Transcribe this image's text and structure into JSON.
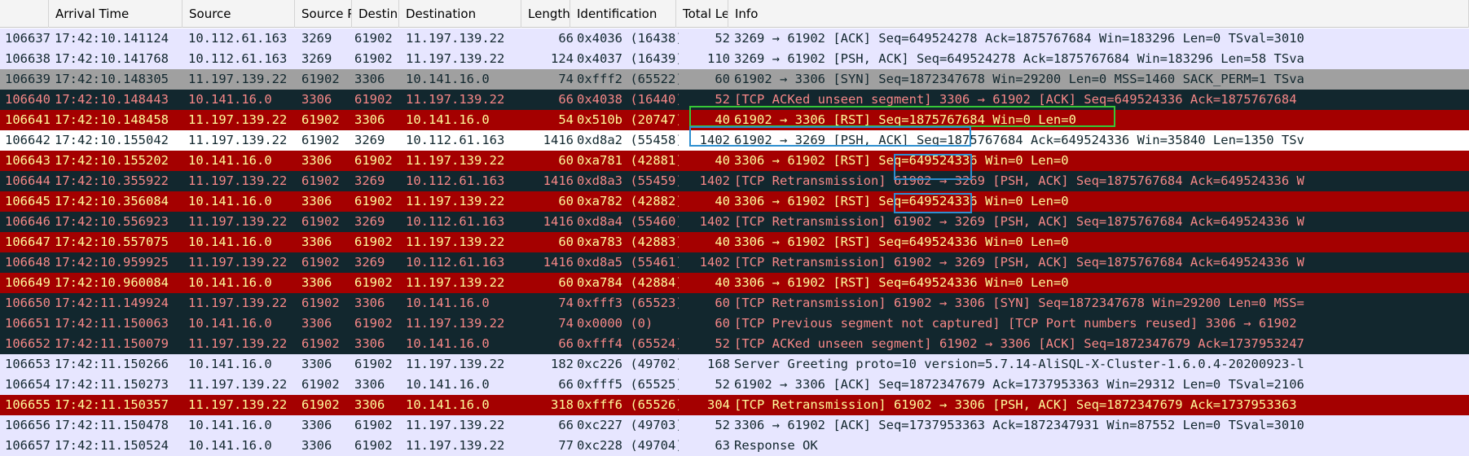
{
  "columns": [
    "",
    "Arrival Time",
    "Source",
    "Source P",
    "Destina",
    "Destination",
    "Length",
    "Identification",
    "Total Le",
    "Info"
  ],
  "styles": {
    "normal": {
      "bg": "#e7e6ff",
      "fg": "#12272e"
    },
    "white": {
      "bg": "#ffffff",
      "fg": "#12272e"
    },
    "gray": {
      "bg": "#a0a0a0",
      "fg": "#12272e"
    },
    "dark": {
      "bg": "#12272e",
      "fg": "#f78787"
    },
    "red": {
      "bg": "#a40000",
      "fg": "#fffc9c"
    }
  },
  "highlight_colors": {
    "green": "#37c837",
    "blue": "#2d8fd0"
  },
  "rows": [
    {
      "style": "normal",
      "c": [
        "106637",
        "17:42:10.141124",
        "10.112.61.163",
        "3269",
        "61902",
        "11.197.139.22",
        "66",
        "0x4036 (16438)",
        "52",
        "3269 → 61902 [ACK] Seq=649524278 Ack=1875767684 Win=183296 Len=0 TSval=3010"
      ]
    },
    {
      "style": "normal",
      "c": [
        "106638",
        "17:42:10.141768",
        "10.112.61.163",
        "3269",
        "61902",
        "11.197.139.22",
        "124",
        "0x4037 (16439)",
        "110",
        "3269 → 61902 [PSH, ACK] Seq=649524278 Ack=1875767684 Win=183296 Len=58 TSva"
      ]
    },
    {
      "style": "gray",
      "c": [
        "106639",
        "17:42:10.148305",
        "11.197.139.22",
        "61902",
        "3306",
        "10.141.16.0",
        "74",
        "0xfff2 (65522)",
        "60",
        "61902 → 3306 [SYN] Seq=1872347678 Win=29200 Len=0 MSS=1460 SACK_PERM=1 TSva"
      ]
    },
    {
      "style": "dark",
      "c": [
        "106640",
        "17:42:10.148443",
        "10.141.16.0",
        "3306",
        "61902",
        "11.197.139.22",
        "66",
        "0x4038 (16440)",
        "52",
        "[TCP ACKed unseen segment] 3306 → 61902 [ACK] Seq=649524336 Ack=1875767684"
      ]
    },
    {
      "style": "red",
      "c": [
        "106641",
        "17:42:10.148458",
        "11.197.139.22",
        "61902",
        "3306",
        "10.141.16.0",
        "54",
        "0x510b (20747)",
        "40",
        "61902 → 3306 [RST] Seq=1875767684 Win=0 Len=0"
      ]
    },
    {
      "style": "white",
      "c": [
        "106642",
        "17:42:10.155042",
        "11.197.139.22",
        "61902",
        "3269",
        "10.112.61.163",
        "1416",
        "0xd8a2 (55458)",
        "1402",
        "61902 → 3269 [PSH, ACK] Seq=1875767684 Ack=649524336 Win=35840 Len=1350 TSv"
      ]
    },
    {
      "style": "red",
      "c": [
        "106643",
        "17:42:10.155202",
        "10.141.16.0",
        "3306",
        "61902",
        "11.197.139.22",
        "60",
        "0xa781 (42881)",
        "40",
        "3306 → 61902 [RST] Seq=649524336 Win=0 Len=0"
      ]
    },
    {
      "style": "dark",
      "c": [
        "106644",
        "17:42:10.355922",
        "11.197.139.22",
        "61902",
        "3269",
        "10.112.61.163",
        "1416",
        "0xd8a3 (55459)",
        "1402",
        "[TCP Retransmission] 61902 → 3269 [PSH, ACK] Seq=1875767684 Ack=649524336 W"
      ]
    },
    {
      "style": "red",
      "c": [
        "106645",
        "17:42:10.356084",
        "10.141.16.0",
        "3306",
        "61902",
        "11.197.139.22",
        "60",
        "0xa782 (42882)",
        "40",
        "3306 → 61902 [RST] Seq=649524336 Win=0 Len=0"
      ]
    },
    {
      "style": "dark",
      "c": [
        "106646",
        "17:42:10.556923",
        "11.197.139.22",
        "61902",
        "3269",
        "10.112.61.163",
        "1416",
        "0xd8a4 (55460)",
        "1402",
        "[TCP Retransmission] 61902 → 3269 [PSH, ACK] Seq=1875767684 Ack=649524336 W"
      ]
    },
    {
      "style": "red",
      "c": [
        "106647",
        "17:42:10.557075",
        "10.141.16.0",
        "3306",
        "61902",
        "11.197.139.22",
        "60",
        "0xa783 (42883)",
        "40",
        "3306 → 61902 [RST] Seq=649524336 Win=0 Len=0"
      ]
    },
    {
      "style": "dark",
      "c": [
        "106648",
        "17:42:10.959925",
        "11.197.139.22",
        "61902",
        "3269",
        "10.112.61.163",
        "1416",
        "0xd8a5 (55461)",
        "1402",
        "[TCP Retransmission] 61902 → 3269 [PSH, ACK] Seq=1875767684 Ack=649524336 W"
      ]
    },
    {
      "style": "red",
      "c": [
        "106649",
        "17:42:10.960084",
        "10.141.16.0",
        "3306",
        "61902",
        "11.197.139.22",
        "60",
        "0xa784 (42884)",
        "40",
        "3306 → 61902 [RST] Seq=649524336 Win=0 Len=0"
      ]
    },
    {
      "style": "dark",
      "c": [
        "106650",
        "17:42:11.149924",
        "11.197.139.22",
        "61902",
        "3306",
        "10.141.16.0",
        "74",
        "0xfff3 (65523)",
        "60",
        "[TCP Retransmission] 61902 → 3306 [SYN] Seq=1872347678 Win=29200 Len=0 MSS="
      ]
    },
    {
      "style": "dark",
      "c": [
        "106651",
        "17:42:11.150063",
        "10.141.16.0",
        "3306",
        "61902",
        "11.197.139.22",
        "74",
        "0x0000 (0)",
        "60",
        "[TCP Previous segment not captured] [TCP Port numbers reused] 3306 → 61902"
      ]
    },
    {
      "style": "dark",
      "c": [
        "106652",
        "17:42:11.150079",
        "11.197.139.22",
        "61902",
        "3306",
        "10.141.16.0",
        "66",
        "0xfff4 (65524)",
        "52",
        "[TCP ACKed unseen segment] 61902 → 3306 [ACK] Seq=1872347679 Ack=1737953247"
      ]
    },
    {
      "style": "normal",
      "c": [
        "106653",
        "17:42:11.150266",
        "10.141.16.0",
        "3306",
        "61902",
        "11.197.139.22",
        "182",
        "0xc226 (49702)",
        "168",
        "Server Greeting proto=10 version=5.7.14-AliSQL-X-Cluster-1.6.0.4-20200923-l"
      ]
    },
    {
      "style": "normal",
      "c": [
        "106654",
        "17:42:11.150273",
        "11.197.139.22",
        "61902",
        "3306",
        "10.141.16.0",
        "66",
        "0xfff5 (65525)",
        "52",
        "61902 → 3306 [ACK] Seq=1872347679 Ack=1737953363 Win=29312 Len=0 TSval=2106"
      ]
    },
    {
      "style": "red",
      "c": [
        "106655",
        "17:42:11.150357",
        "11.197.139.22",
        "61902",
        "3306",
        "10.141.16.0",
        "318",
        "0xfff6 (65526)",
        "304",
        "[TCP Retransmission] 61902 → 3306 [PSH, ACK] Seq=1872347679 Ack=1737953363"
      ]
    },
    {
      "style": "normal",
      "c": [
        "106656",
        "17:42:11.150478",
        "10.141.16.0",
        "3306",
        "61902",
        "11.197.139.22",
        "66",
        "0xc227 (49703)",
        "52",
        "3306 → 61902 [ACK] Seq=1737953363 Ack=1872347931 Win=87552 Len=0 TSval=3010"
      ]
    },
    {
      "style": "normal",
      "c": [
        "106657",
        "17:42:11.150524",
        "10.141.16.0",
        "3306",
        "61902",
        "11.197.139.22",
        "77",
        "0xc228 (49704)",
        "63",
        "Response OK"
      ]
    }
  ]
}
